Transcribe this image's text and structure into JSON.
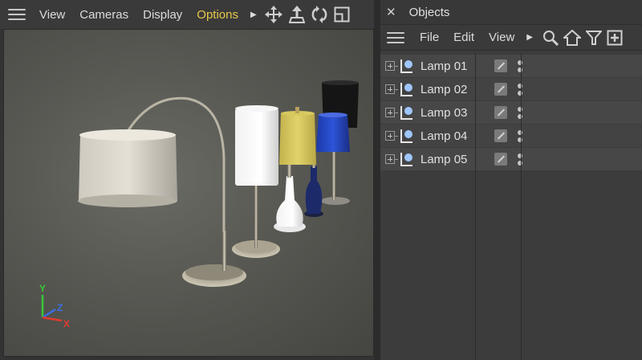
{
  "viewport": {
    "menu": [
      {
        "label": "View",
        "active": false
      },
      {
        "label": "Cameras",
        "active": false
      },
      {
        "label": "Display",
        "active": false
      },
      {
        "label": "Options",
        "active": true
      }
    ],
    "more_arrow": "▶",
    "nav_icons": [
      "move-icon",
      "zoom-icon",
      "rotate-icon",
      "maximize-icon"
    ],
    "axis": {
      "y": "Y",
      "z": "Z",
      "x": "X"
    }
  },
  "objects": {
    "title": "Objects",
    "close_glyph": "✕",
    "menu": [
      "File",
      "Edit",
      "View"
    ],
    "more_arrow": "▶",
    "tools": [
      "search-icon",
      "home-icon",
      "filter-icon",
      "new-window-icon"
    ],
    "items": [
      {
        "label": "Lamp 01"
      },
      {
        "label": "Lamp 02"
      },
      {
        "label": "Lamp 03"
      },
      {
        "label": "Lamp 04"
      },
      {
        "label": "Lamp 05"
      }
    ]
  },
  "colors": {
    "accent_active_menu": "#e8c84a",
    "axis_y": "#37c837",
    "axis_z": "#3a6fe6",
    "axis_x": "#e03a2e"
  }
}
